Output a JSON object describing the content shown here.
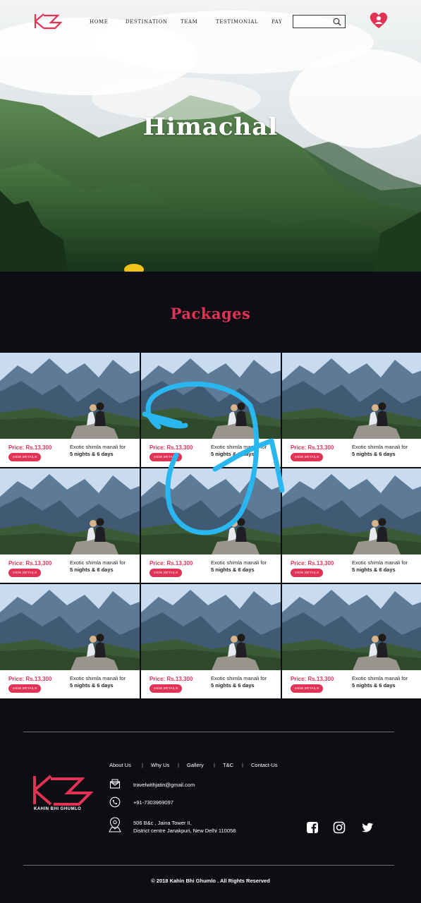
{
  "nav": {
    "links": [
      "HOME",
      "DESTINATION",
      "TEAM",
      "TESTIMONIAL",
      "PAY"
    ],
    "search_placeholder": ""
  },
  "hero": {
    "title": "Himachal"
  },
  "packages": {
    "title": "Packages",
    "cards": [
      {
        "price": "Price: Rs.13,300",
        "button": "VIEW DETAILS",
        "desc_line1": "Exotic shimla manali for",
        "desc_line2": "5 nights & 6 days"
      },
      {
        "price": "Price: Rs.13,300",
        "button": "VIEW DETAILS",
        "desc_line1": "Exotic shimla manali for",
        "desc_line2": "5 nights & 6 days"
      },
      {
        "price": "Price: Rs.13,300",
        "button": "VIEW DETAILS",
        "desc_line1": "Exotic shimla manali for",
        "desc_line2": "5 nights & 6 days"
      },
      {
        "price": "Price: Rs.13,300",
        "button": "VIEW DETAILS",
        "desc_line1": "Exotic shimla manali for",
        "desc_line2": "5 nights & 6 days"
      },
      {
        "price": "Price: Rs.13,300",
        "button": "VIEW DETAILS",
        "desc_line1": "Exotic shimla manali for",
        "desc_line2": "5 nights & 6 days"
      },
      {
        "price": "Price: Rs.13,300",
        "button": "VIEW DETAILS",
        "desc_line1": "Exotic shimla manali for",
        "desc_line2": "5 nights & 6 days"
      },
      {
        "price": "Price: Rs.13,300",
        "button": "VIEW DETAILS",
        "desc_line1": "Exotic shimla manali for",
        "desc_line2": "5 nights & 6 days"
      },
      {
        "price": "Price: Rs.13,300",
        "button": "VIEW DETAILS",
        "desc_line1": "Exotic shimla manali for",
        "desc_line2": "5 nights & 6 days"
      },
      {
        "price": "Price: Rs.13,300",
        "button": "VIEW DETAILS",
        "desc_line1": "Exotic shimla manali for",
        "desc_line2": "5 nights & 6 days"
      }
    ]
  },
  "footer": {
    "links": [
      "About Us",
      "Why Us",
      "Gallery",
      "T&C",
      "Contact-Us"
    ],
    "brand": "KAHIN BHI GHUMLO",
    "email": "travelwithjatin@gmail.com",
    "phone": "+91-7303969097",
    "address_line1": "506 B&c , Jaina Tower II,",
    "address_line2": "District centre Janakpuri, New Delhi 110058",
    "social_icons": [
      "facebook-icon",
      "instagram-icon",
      "twitter-icon"
    ],
    "copyright": "© 2018 Kahin Bhi Ghumlo . All Rights Reserved"
  },
  "colors": {
    "accent": "#e23355",
    "background": "#0e0d14",
    "scribble": "#2ab7f0"
  }
}
